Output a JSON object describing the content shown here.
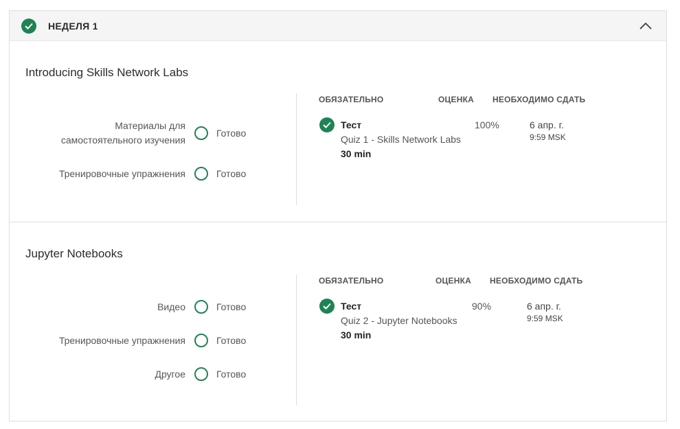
{
  "week": {
    "title": "НЕДЕЛЯ 1",
    "completed_icon": "check-circle-icon",
    "collapse_icon": "chevron-up-icon"
  },
  "colors": {
    "accent": "#1f8354",
    "header_bg": "#f5f5f5",
    "border": "#dddddd"
  },
  "columns": {
    "required": "ОБЯЗАТЕЛЬНО",
    "grade": "ОЦЕНКА",
    "due": "НЕОБХОДИМО СДАТЬ"
  },
  "sections": [
    {
      "title": "Introducing Skills Network Labs",
      "items": [
        {
          "label_line1": "Материалы для",
          "label_line2": "самостоятельного изучения",
          "status": "Готово"
        },
        {
          "label": "Тренировочные упражнения",
          "status": "Готово"
        }
      ],
      "task": {
        "type": "Тест",
        "name": "Quiz 1 - Skills Network Labs",
        "duration": "30 min",
        "grade": "100%",
        "due_date": "6 апр. г.",
        "due_time": "9:59 MSK"
      }
    },
    {
      "title": "Jupyter Notebooks",
      "items": [
        {
          "label": "Видео",
          "status": "Готово"
        },
        {
          "label": "Тренировочные упражнения",
          "status": "Готово"
        },
        {
          "label": "Другое",
          "status": "Готово"
        }
      ],
      "task": {
        "type": "Тест",
        "name": "Quiz 2 - Jupyter Notebooks",
        "duration": "30 min",
        "grade": "90%",
        "due_date": "6 апр. г.",
        "due_time": "9:59 MSK"
      }
    }
  ]
}
